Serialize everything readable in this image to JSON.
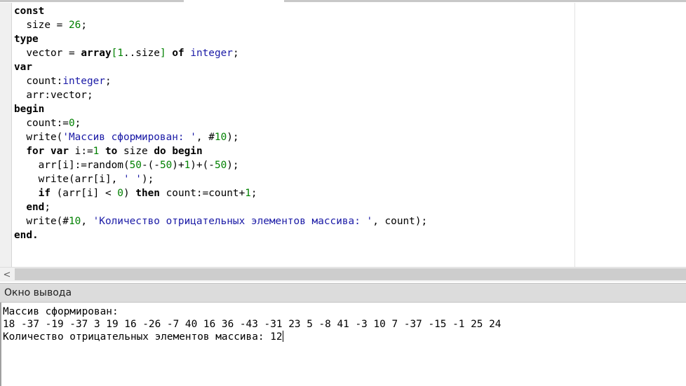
{
  "editor": {
    "lines": [
      [
        {
          "t": "const",
          "c": "kw"
        }
      ],
      [
        {
          "t": "  size = "
        },
        {
          "t": "26",
          "c": "num"
        },
        {
          "t": ";"
        }
      ],
      [
        {
          "t": "type",
          "c": "kw"
        }
      ],
      [
        {
          "t": "  vector = "
        },
        {
          "t": "array",
          "c": "kw"
        },
        {
          "t": "[",
          "c": "br"
        },
        {
          "t": "1",
          "c": "num"
        },
        {
          "t": "..size"
        },
        {
          "t": "]",
          "c": "br"
        },
        {
          "t": " "
        },
        {
          "t": "of",
          "c": "kw"
        },
        {
          "t": " "
        },
        {
          "t": "integer",
          "c": "ty"
        },
        {
          "t": ";"
        }
      ],
      [
        {
          "t": "var",
          "c": "kw"
        }
      ],
      [
        {
          "t": "  count:"
        },
        {
          "t": "integer",
          "c": "ty"
        },
        {
          "t": ";"
        }
      ],
      [
        {
          "t": "  arr:vector;"
        }
      ],
      [
        {
          "t": "begin",
          "c": "kw"
        }
      ],
      [
        {
          "t": "  count:="
        },
        {
          "t": "0",
          "c": "num"
        },
        {
          "t": ";"
        }
      ],
      [
        {
          "t": "  write("
        },
        {
          "t": "'Массив сформирован: '",
          "c": "str"
        },
        {
          "t": ", #"
        },
        {
          "t": "10",
          "c": "num"
        },
        {
          "t": ");"
        }
      ],
      [
        {
          "t": "  "
        },
        {
          "t": "for",
          "c": "kw"
        },
        {
          "t": " "
        },
        {
          "t": "var",
          "c": "kw"
        },
        {
          "t": " i:="
        },
        {
          "t": "1",
          "c": "num"
        },
        {
          "t": " "
        },
        {
          "t": "to",
          "c": "kw"
        },
        {
          "t": " size "
        },
        {
          "t": "do",
          "c": "kw"
        },
        {
          "t": " "
        },
        {
          "t": "begin",
          "c": "kw"
        }
      ],
      [
        {
          "t": "    arr[i]:=random("
        },
        {
          "t": "50",
          "c": "num"
        },
        {
          "t": "-(-"
        },
        {
          "t": "50",
          "c": "num"
        },
        {
          "t": ")+"
        },
        {
          "t": "1",
          "c": "num"
        },
        {
          "t": ")+(-"
        },
        {
          "t": "50",
          "c": "num"
        },
        {
          "t": ");"
        }
      ],
      [
        {
          "t": "    write(arr[i], "
        },
        {
          "t": "' '",
          "c": "str"
        },
        {
          "t": ");"
        }
      ],
      [
        {
          "t": "    "
        },
        {
          "t": "if",
          "c": "kw"
        },
        {
          "t": " (arr[i] < "
        },
        {
          "t": "0",
          "c": "num"
        },
        {
          "t": ") "
        },
        {
          "t": "then",
          "c": "kw"
        },
        {
          "t": " count:=count+"
        },
        {
          "t": "1",
          "c": "num"
        },
        {
          "t": ";"
        }
      ],
      [
        {
          "t": "  "
        },
        {
          "t": "end",
          "c": "kw"
        },
        {
          "t": ";"
        }
      ],
      [
        {
          "t": "  write(#"
        },
        {
          "t": "10",
          "c": "num"
        },
        {
          "t": ", "
        },
        {
          "t": "'Количество отрицательных элементов массива: '",
          "c": "str"
        },
        {
          "t": ", count);"
        }
      ],
      [
        {
          "t": "end.",
          "c": "kw"
        }
      ]
    ]
  },
  "scrollbar": {
    "left_arrow": "<"
  },
  "output_panel": {
    "title": "Окно вывода",
    "lines": [
      "Массив сформирован:",
      "18 -37 -19 -37 3 19 16 -26 -7 40 16 36 -43 -31 23 5 -8 41 -3 10 7 -37 -15 -1 25 24",
      "Количество отрицательных элементов массива: 12"
    ]
  },
  "colors": {
    "keyword": "#000000",
    "type": "#1a1aa6",
    "number": "#008000",
    "string": "#1a1aa6",
    "output_header_bg": "#dcdcdc"
  }
}
